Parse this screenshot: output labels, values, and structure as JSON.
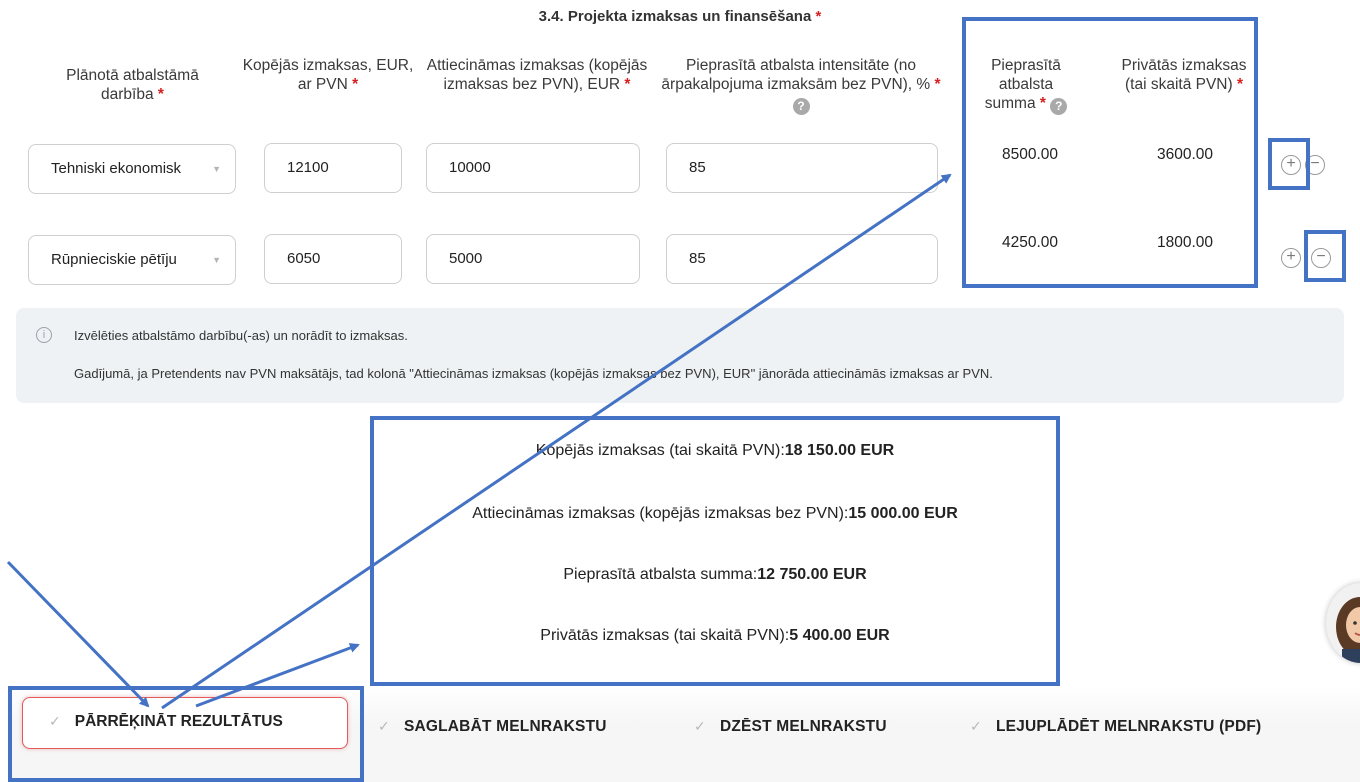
{
  "section": {
    "title": "3.4. Projekta izmaksas un finansēšana",
    "required": "*"
  },
  "headers": {
    "activity": "Plānotā atbalstāmā darbība",
    "total": "Kopējās izmaksas, EUR, ar PVN",
    "eligible": "Attiecināmas izmaksas (kopējās izmaksas bez PVN), EUR",
    "intensity": "Pieprasītā atbalsta intensitāte (no ārpakalpojuma izmaksām bez PVN), %",
    "requested": "Pieprasītā atbalsta summa",
    "private": "Privātās izmaksas (tai skaitā PVN)",
    "required": "*",
    "help": "?"
  },
  "rows": [
    {
      "activity": "Tehniski ekonomisk",
      "total": "12100",
      "eligible": "10000",
      "intensity": "85",
      "requested": "8500.00",
      "private": "3600.00"
    },
    {
      "activity": "Rūpnieciskie pētīju",
      "total": "6050",
      "eligible": "5000",
      "intensity": "85",
      "requested": "4250.00",
      "private": "1800.00"
    }
  ],
  "row_buttons": {
    "add": "+",
    "remove": "−"
  },
  "info": {
    "icon": "i",
    "line1": "Izvēlēties atbalstāmo darbību(-as) un norādīt to izmaksas.",
    "line2": "Gadījumā, ja Pretendents nav PVN maksātājs, tad kolonā \"Attiecināmas izmaksas (kopējās izmaksas bez PVN), EUR\" jānorāda attiecināmās izmaksas ar PVN."
  },
  "summary": [
    {
      "label": "Kopējās izmaksas (tai skaitā PVN):",
      "value": "18 150.00 EUR"
    },
    {
      "label": "Attiecināmas izmaksas (kopējās izmaksas bez PVN):",
      "value": "15 000.00 EUR"
    },
    {
      "label": "Pieprasītā atbalsta summa:",
      "value": "12 750.00 EUR"
    },
    {
      "label": "Privātās izmaksas (tai skaitā PVN):",
      "value": "5 400.00 EUR"
    }
  ],
  "footer": {
    "recalculate": "PĀRRĒĶINĀT REZULTĀTUS",
    "save_draft": "SAGLABĀT MELNRAKSTU",
    "delete_draft": "DZĒST MELNRAKSTU",
    "download_draft": "LEJUPLĀDĒT MELNRAKSTU (PDF)",
    "check": "✓"
  },
  "colors": {
    "annotation": "#4472c4",
    "required": "#d62020",
    "recalc_border": "#e25a5a",
    "info_bg": "#eef2f4"
  }
}
